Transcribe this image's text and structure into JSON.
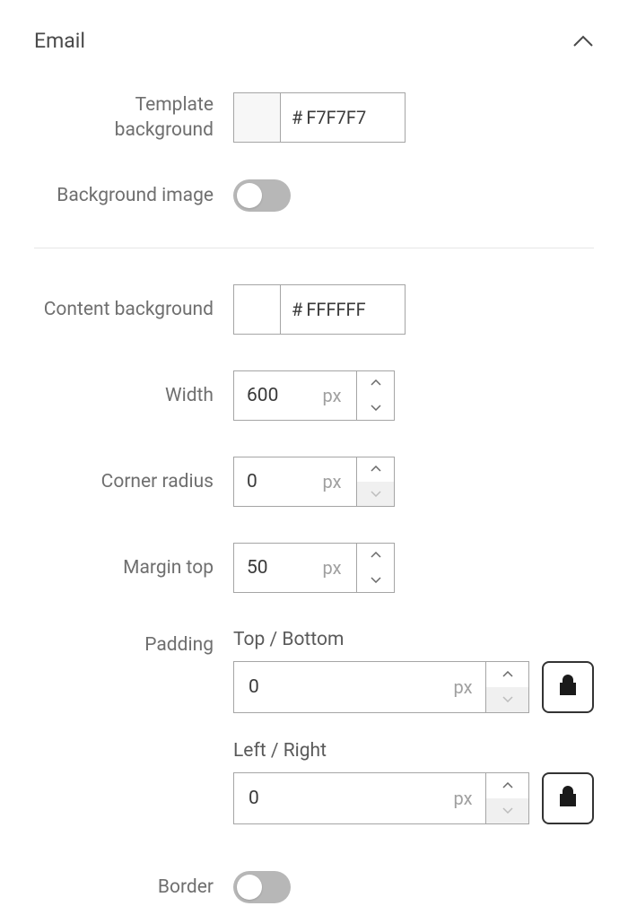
{
  "section": {
    "title": "Email"
  },
  "template_background": {
    "label": "Template background",
    "value_hex": "F7F7F7",
    "swatch_color": "#F7F7F7"
  },
  "background_image": {
    "label": "Background image",
    "enabled": false
  },
  "content_background": {
    "label": "Content background",
    "value_hex": "FFFFFF",
    "swatch_color": "#FFFFFF"
  },
  "width": {
    "label": "Width",
    "value": "600",
    "unit": "px"
  },
  "corner_radius": {
    "label": "Corner radius",
    "value": "0",
    "unit": "px"
  },
  "margin_top": {
    "label": "Margin top",
    "value": "50",
    "unit": "px"
  },
  "padding": {
    "label": "Padding",
    "top_bottom": {
      "label": "Top / Bottom",
      "value": "0",
      "unit": "px",
      "locked": true
    },
    "left_right": {
      "label": "Left / Right",
      "value": "0",
      "unit": "px",
      "locked": true
    }
  },
  "border": {
    "label": "Border",
    "enabled": false
  }
}
